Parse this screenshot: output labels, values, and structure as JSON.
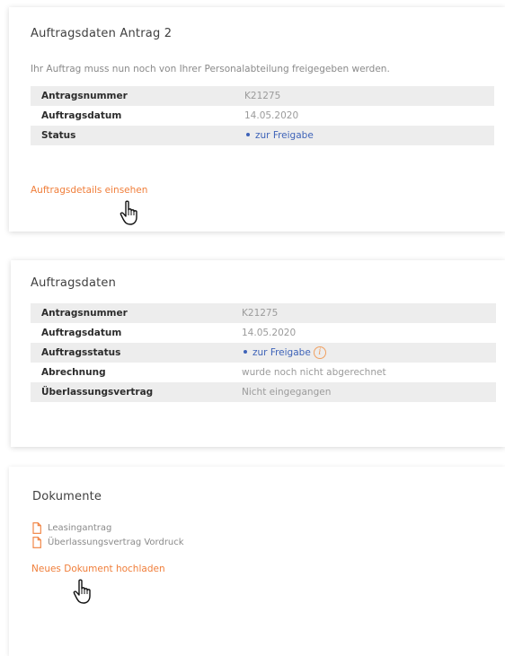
{
  "order_card": {
    "title": "Auftragsdaten Antrag 2",
    "info": "Ihr Auftrag muss nun noch von Ihrer Personalabteilung freigegeben werden.",
    "rows": [
      {
        "key": "Antragsnummer",
        "value": "K21275"
      },
      {
        "key": "Auftragsdatum",
        "value": "14.05.2020"
      },
      {
        "key": "Status",
        "value": "zur Freigabe"
      }
    ],
    "details_link": "Auftragsdetails einsehen"
  },
  "details_card": {
    "title": "Auftragsdaten",
    "rows": [
      {
        "key": "Antragsnummer",
        "value": "K21275"
      },
      {
        "key": "Auftragsdatum",
        "value": "14.05.2020"
      },
      {
        "key": "Auftragsstatus",
        "value": "zur Freigabe"
      },
      {
        "key": "Abrechnung",
        "value": "wurde noch nicht abgerechnet"
      },
      {
        "key": "Überlassungsvertrag",
        "value": "Nicht eingegangen"
      }
    ],
    "info_icon_glyph": "i"
  },
  "documents_card": {
    "title": "Dokumente",
    "documents": [
      {
        "name": "Leasingantrag",
        "icon": "document-icon"
      },
      {
        "name": "Überlassungsvertrag Vordruck",
        "icon": "document-icon"
      }
    ],
    "upload_link": "Neues Dokument hochladen"
  },
  "colors": {
    "accent_orange": "#f07e3a",
    "status_blue": "#3e63b8",
    "row_stripe": "#ededed"
  }
}
